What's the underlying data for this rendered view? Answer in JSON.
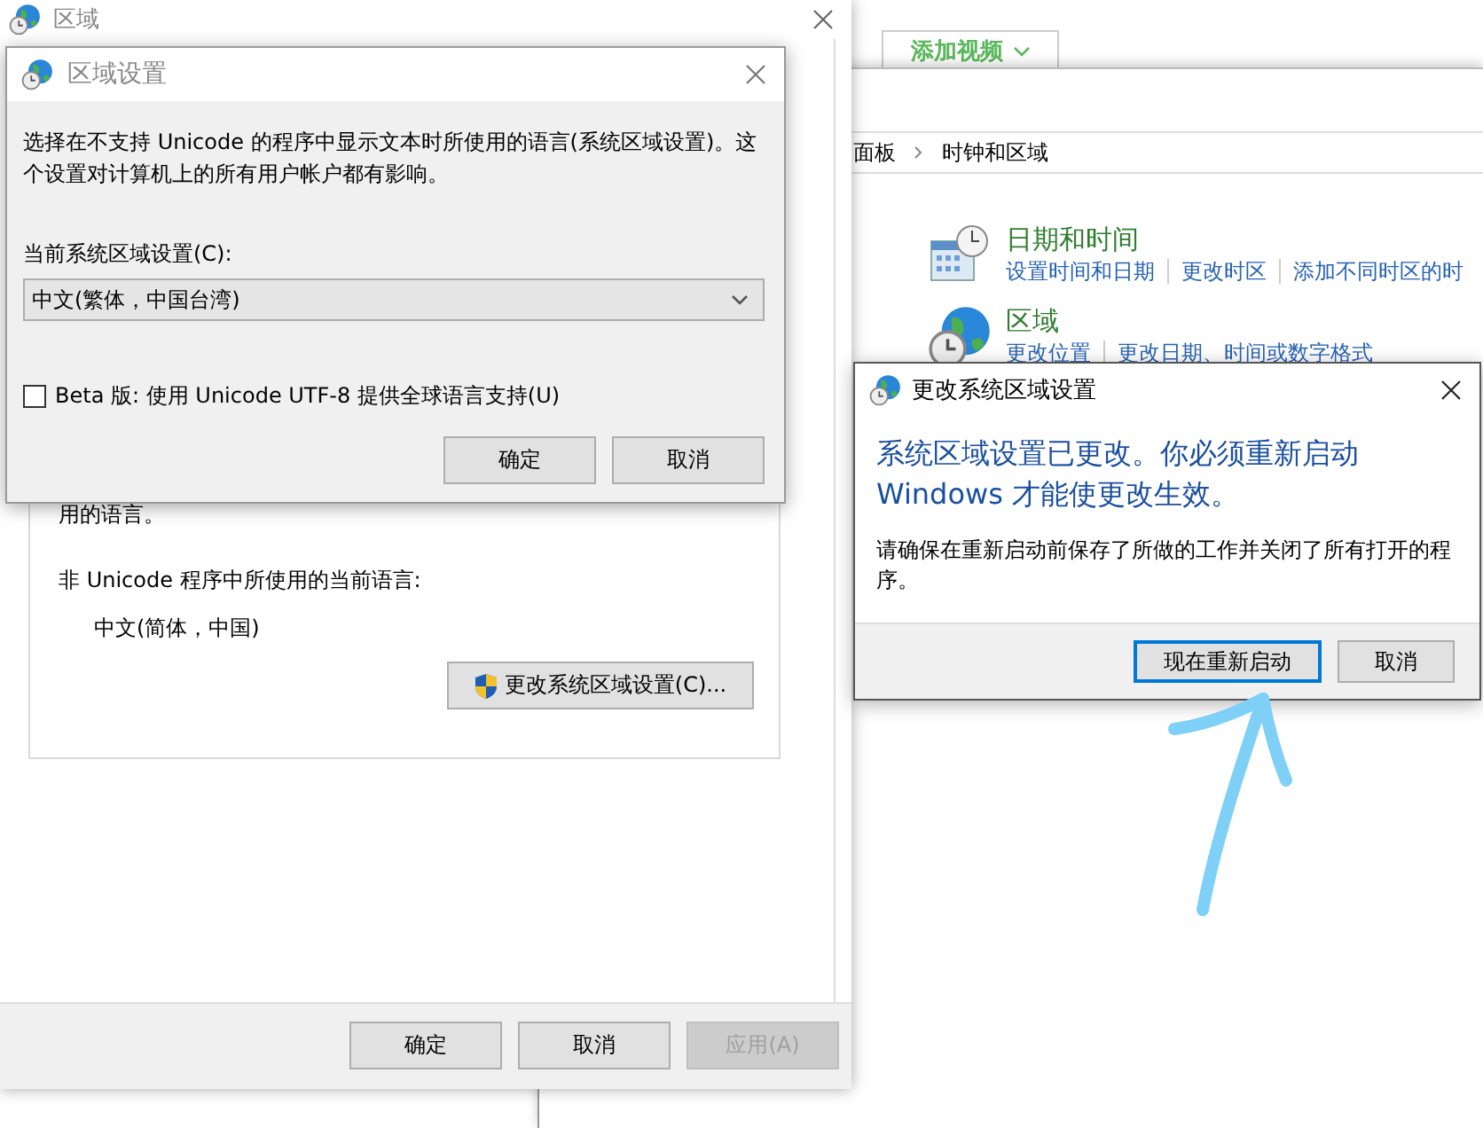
{
  "background_tab": {
    "label": "添加视频"
  },
  "control_panel": {
    "breadcrumb": [
      "面板",
      "时钟和区域"
    ],
    "categories": [
      {
        "kind": "clock",
        "title": "日期和时间",
        "links": [
          "设置时间和日期",
          "更改时区",
          "添加不同时区的时"
        ]
      },
      {
        "kind": "globe",
        "title": "区域",
        "links": [
          "更改位置",
          "更改日期、时间或数字格式"
        ]
      }
    ]
  },
  "region_window": {
    "title": "区域",
    "panel_text": "用的语言。",
    "current_language_label": "非 Unicode 程序中所使用的当前语言:",
    "current_language": "中文(简体，中国)",
    "change_button": "更改系统区域设置(C)...",
    "buttons": [
      {
        "label": "确定",
        "disabled": false
      },
      {
        "label": "取消",
        "disabled": false
      },
      {
        "label": "应用(A)",
        "disabled": true
      }
    ]
  },
  "locale_dialog": {
    "title": "区域设置",
    "description": "选择在不支持 Unicode 的程序中显示文本时所使用的语言(系统区域设置)。这个设置对计算机上的所有用户帐户都有影响。",
    "locale_label": "当前系统区域设置(C):",
    "locale_value": "中文(繁体，中国台湾)",
    "beta": {
      "label": "Beta 版: 使用 Unicode UTF-8 提供全球语言支持(U)",
      "checked": false
    },
    "buttons": [
      "确定",
      "取消"
    ]
  },
  "restart_dialog": {
    "title": "更改系统区域设置",
    "heading": "系统区域设置已更改。你必须重新启动 Windows 才能使更改生效。",
    "message": "请确保在重新启动前保存了所做的工作并关闭了所有打开的程序。",
    "buttons": [
      {
        "label": "现在重新启动",
        "default": true
      },
      {
        "label": "取消",
        "default": false
      }
    ]
  }
}
